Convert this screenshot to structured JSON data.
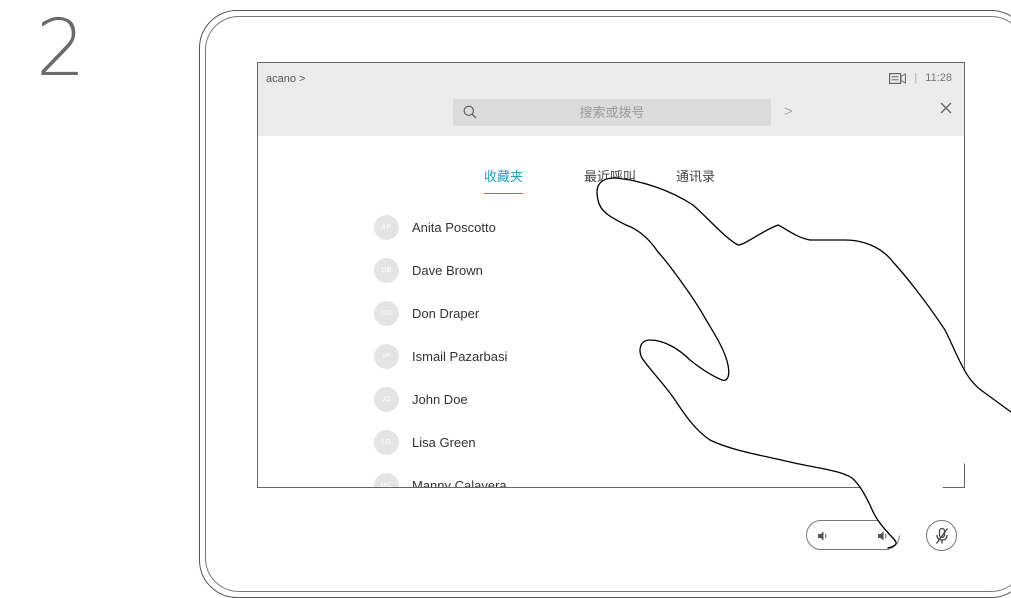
{
  "step": {
    "number": "2"
  },
  "topbar": {
    "breadcrumb": "acano >",
    "time": "11:28",
    "divider": "|",
    "search_placeholder": "搜索或拨号",
    "arrow_label": ">",
    "close_label": "×"
  },
  "tabs": [
    {
      "label": "收藏夹",
      "active": true
    },
    {
      "label": "最近呼叫",
      "active": false
    },
    {
      "label": "通讯录",
      "active": false
    }
  ],
  "contacts": [
    {
      "initials": "AP",
      "name": "Anita Poscotto"
    },
    {
      "initials": "DB",
      "name": "Dave Brown"
    },
    {
      "initials": "DD",
      "name": "Don Draper"
    },
    {
      "initials": "IP",
      "name": "Ismail Pazarbasi"
    },
    {
      "initials": "JD",
      "name": "John Doe"
    },
    {
      "initials": "LG",
      "name": "Lisa Green"
    },
    {
      "initials": "MC",
      "name": "Manny Calavera"
    }
  ],
  "icons": {
    "search": "search-icon",
    "camera": "camera-icon",
    "close": "close-icon",
    "volume": "speaker-icon",
    "mute": "microphone-muted-icon",
    "hand": "pointing-hand-icon"
  },
  "colors": {
    "accent": "#1fa2c7",
    "topbar_bg": "#ececec",
    "avatar_bg": "#e4e4e4"
  }
}
